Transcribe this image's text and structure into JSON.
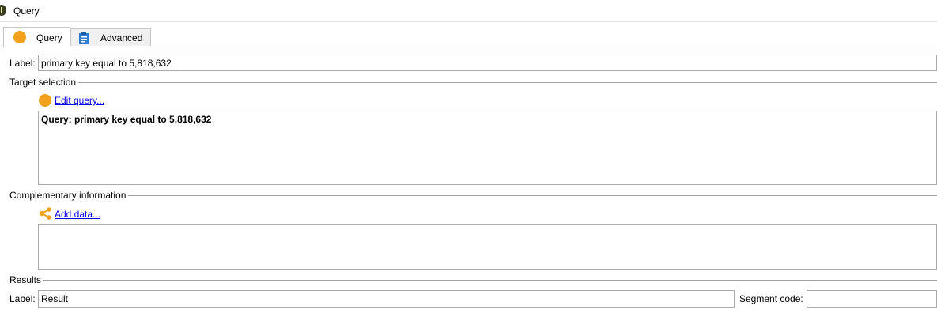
{
  "window": {
    "title": "Query"
  },
  "tabs": [
    {
      "label": "Query",
      "active": true,
      "icon": "orange-circle-icon"
    },
    {
      "label": "Advanced",
      "active": false,
      "icon": "clipboard-icon"
    }
  ],
  "label_field": {
    "label": "Label:",
    "value": "primary key equal to 5,818,632"
  },
  "target_selection": {
    "title": "Target selection",
    "edit_link": "Edit query...",
    "query_text": "Query: primary key equal to 5,818,632"
  },
  "complementary": {
    "title": "Complementary information",
    "add_link": "Add data..."
  },
  "results": {
    "title": "Results",
    "label_caption": "Label:",
    "label_value": "Result",
    "segment_caption": "Segment code:",
    "segment_value": ""
  },
  "colors": {
    "accent_orange": "#f2a11d",
    "link_blue": "#0000ee",
    "clipboard_blue": "#2b7fd6"
  }
}
